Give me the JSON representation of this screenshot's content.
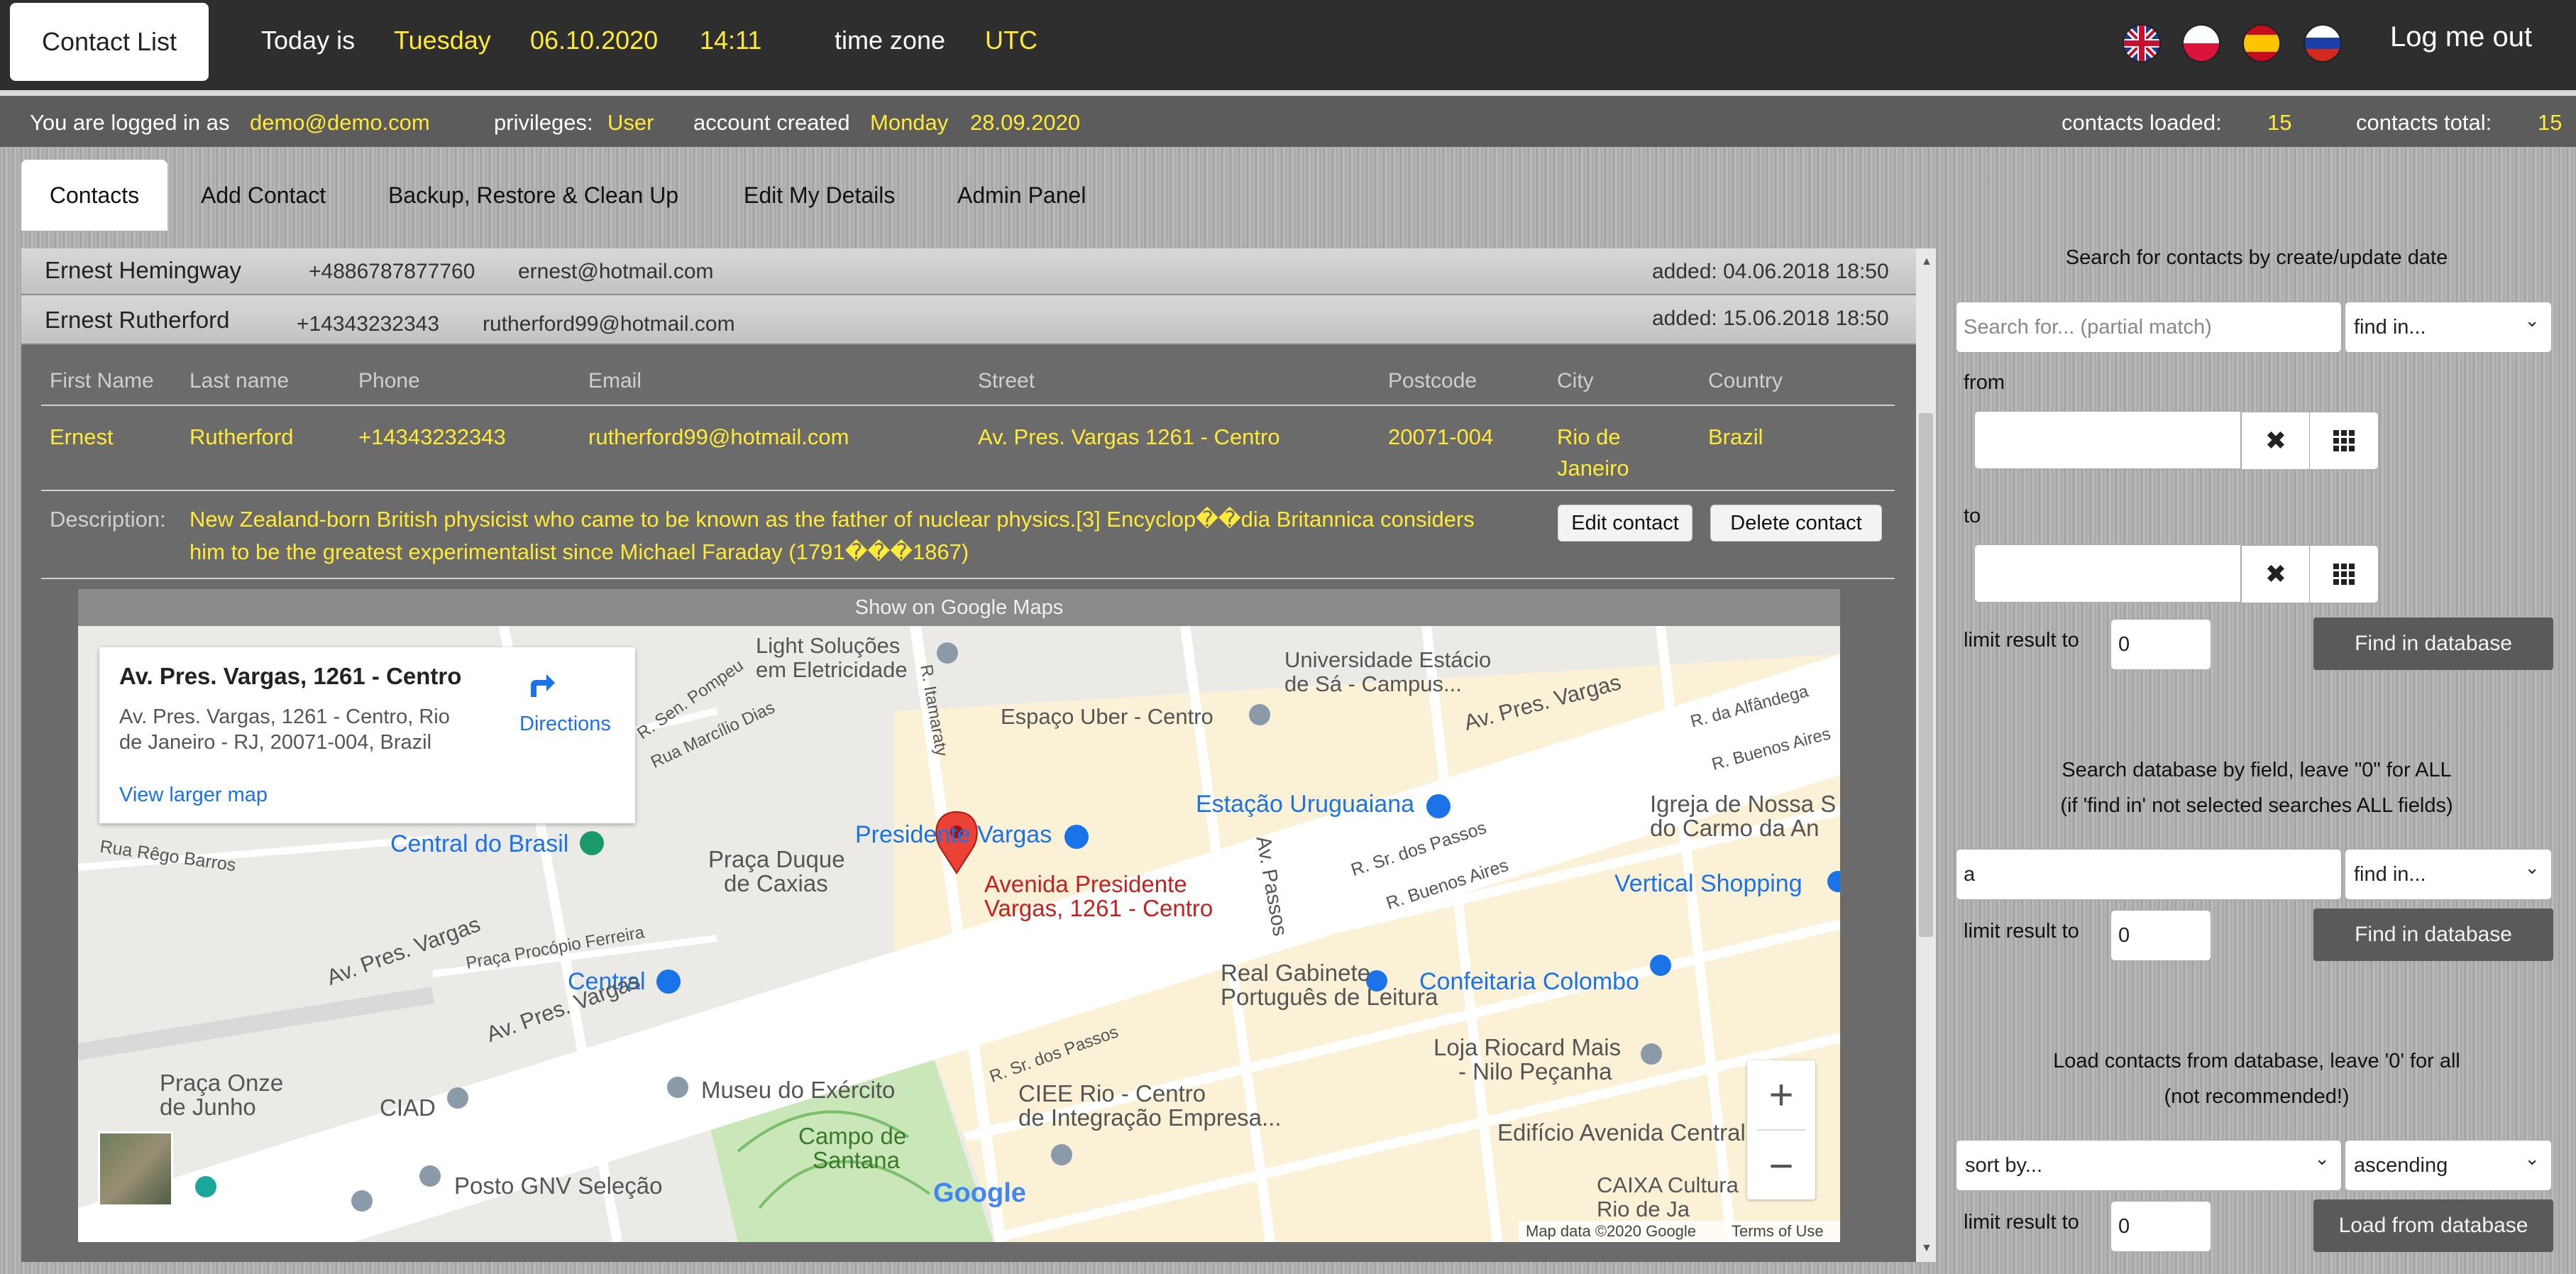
{
  "topbar": {
    "brand": "Contact List",
    "today_label": "Today is",
    "weekday": "Tuesday",
    "date": "06.10.2020",
    "time": "14:11",
    "timezone_label": "time zone",
    "timezone": "UTC",
    "logout_label": "Log me out"
  },
  "infobar": {
    "logged_in_label": "You are logged in as",
    "email": "demo@demo.com",
    "privileges_label": "privileges:",
    "privileges": "User",
    "created_label": "account created",
    "created_day": "Monday",
    "created_date": "28.09.2020",
    "loaded_label": "contacts loaded:",
    "loaded": "15",
    "total_label": "contacts total:",
    "total": "15"
  },
  "tabs": [
    "Contacts",
    "Add Contact",
    "Backup, Restore & Clean Up",
    "Edit My Details",
    "Admin Panel"
  ],
  "contacts": [
    {
      "name": "Ernest Hemingway",
      "phone": "+4886787877760",
      "email": "ernest@hotmail.com",
      "added": "added: 04.06.2018 18:50"
    },
    {
      "name": "Ernest Rutherford",
      "phone": "+14343232343",
      "email": "rutherford99@hotmail.com",
      "added": "added: 15.06.2018 18:50"
    }
  ],
  "details": {
    "headers": [
      "First Name",
      "Last name",
      "Phone",
      "Email",
      "Street",
      "Postcode",
      "City",
      "Country"
    ],
    "first_name": "Ernest",
    "last_name": "Rutherford",
    "phone": "+14343232343",
    "email": "rutherford99@hotmail.com",
    "street": "Av. Pres. Vargas 1261 - Centro",
    "postcode": "20071-004",
    "city_line1": "Rio de",
    "city_line2": "Janeiro",
    "country": "Brazil",
    "description_label": "Description:",
    "description_line1": "New Zealand-born British physicist who came to be known as the father of nuclear physics.[3] Encyclop��dia Britannica considers",
    "description_line2": "him to be the greatest experimentalist since Michael Faraday (1791���1867)",
    "edit_label": "Edit contact",
    "delete_label": "Delete contact",
    "maps_label": "Show on Google Maps"
  },
  "map": {
    "card_title": "Av. Pres. Vargas, 1261 - Centro",
    "card_addr1": "Av. Pres. Vargas, 1261 - Centro, Rio",
    "card_addr2": "de Janeiro - RJ, 20071-004, Brazil",
    "directions": "Directions",
    "larger_map": "View larger map",
    "pin_label1": "Avenida Presidente",
    "pin_label2": "Vargas, 1261 - Centro",
    "attribution": "Map data ©2020 Google",
    "terms": "Terms of Use",
    "logo": "Google",
    "labels": [
      "Light Soluções",
      "em Eletricidade",
      "Universidade Estácio",
      "de Sá - Campus...",
      "Espaço Uber - Centro",
      "Av. Pres. Vargas",
      "Presidente Vargas",
      "Estação Uruguaiana",
      "Igreja de Nossa S",
      "do Carmo da An",
      "Central do Brasil",
      "Praça Duque",
      "de Caxias",
      "Vertical Shopping",
      "Av. Passos",
      "R. Sr. dos Passos",
      "R. Buenos Aires",
      "Central",
      "Real Gabinete",
      "Português de Leitura",
      "Confeitaria Colombo",
      "Av. Pres. Vargas",
      "Av. Pres. Vargas",
      "Praça Onze",
      "de Junho",
      "CIAD",
      "Museu do Exército",
      "Campo de",
      "Santana",
      "CIEE Rio - Centro",
      "de Integração Empresa...",
      "Loja Riocard Mais",
      "- Nilo Peçanha",
      "Edifício Avenida Central",
      "Posto GNV Seleção",
      "CAIXA Cultura",
      "Rio de Ja",
      "Rua Rêgo Barros",
      "Praça Procópio Ferreira",
      "R. Sen. Pompeu",
      "Rua Marcílio Dias",
      "R. Itamaraty",
      "R. da Alfândega",
      "R. Buenos Aires",
      "R. Sr. dos Passos"
    ]
  },
  "right": {
    "date_search_title": "Search for contacts by create/update date",
    "search_placeholder": "Search for... (partial match)",
    "find_in": "find in...",
    "from_label": "from",
    "to_label": "to",
    "limit_label": "limit result to",
    "limit_value": "0",
    "find_btn": "Find in database",
    "field_search_line1": "Search database by field, leave \"0\" for ALL",
    "field_search_line2": "(if 'find in' not selected searches ALL fields)",
    "field_value": "a",
    "load_line1": "Load contacts from database, leave '0' for all",
    "load_line2": "(not recommended!)",
    "sort_by": "sort by...",
    "order": "ascending",
    "load_btn": "Load from database"
  }
}
